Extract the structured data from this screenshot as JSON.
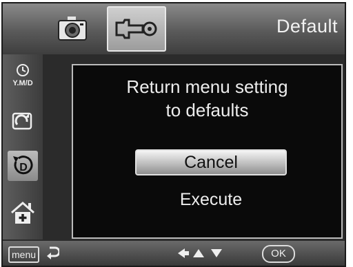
{
  "header": {
    "title": "Default",
    "tabs": [
      {
        "name": "camera",
        "icon": "camera-icon",
        "selected": false
      },
      {
        "name": "settings",
        "icon": "wrench-icon",
        "selected": true
      }
    ]
  },
  "sidebar": {
    "items": [
      {
        "icon": "date-format-icon",
        "label": "Y.M/D",
        "selected": false
      },
      {
        "icon": "rotate-icon",
        "selected": false
      },
      {
        "icon": "default-reset-icon",
        "selected": true
      },
      {
        "icon": "home-plus-icon",
        "selected": false
      }
    ]
  },
  "dialog": {
    "message_line1": "Return menu setting",
    "message_line2": "to defaults",
    "cancel_label": "Cancel",
    "execute_label": "Execute"
  },
  "footer": {
    "menu_label": "menu",
    "ok_label": "OK"
  },
  "colors": {
    "background": "#2b2b2b",
    "dialog_bg": "#0a0a0a",
    "highlight": "#d0d0d0",
    "text": "#ededed"
  }
}
